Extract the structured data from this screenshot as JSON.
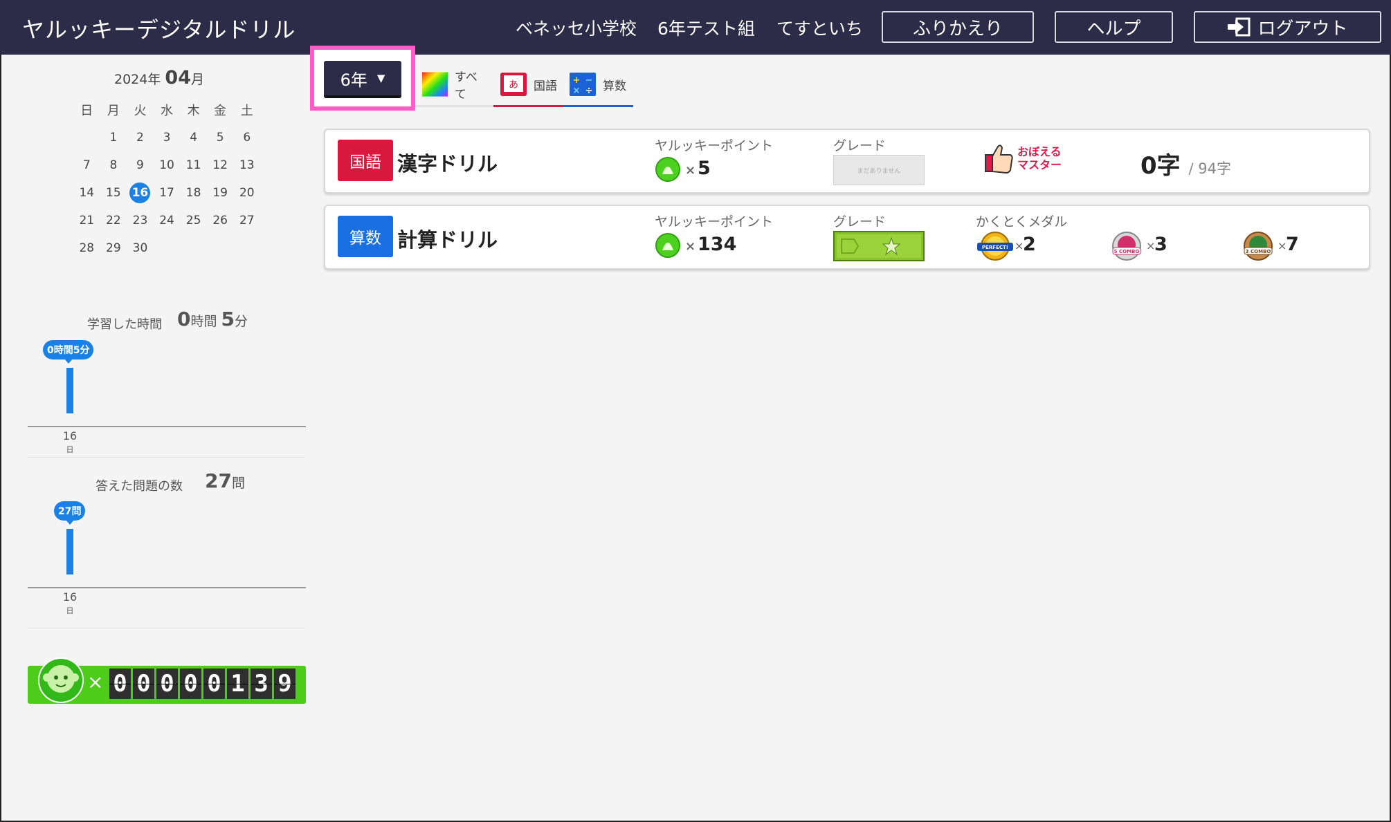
{
  "header": {
    "app_title": "ヤルッキーデジタルドリル",
    "school": "ベネッセ小学校",
    "class_name": "6年テスト組",
    "user_name": "てすといち",
    "review_label": "ふりかえり",
    "help_label": "ヘルプ",
    "logout_label": "ログアウト",
    "bg_color": "#2d2c48"
  },
  "calendar": {
    "year_label": "2024年",
    "month": "04",
    "month_suffix": "月",
    "weekdays": [
      "日",
      "月",
      "火",
      "水",
      "木",
      "金",
      "土"
    ],
    "weeks": [
      [
        "",
        "1",
        "2",
        "3",
        "4",
        "5",
        "6"
      ],
      [
        "7",
        "8",
        "9",
        "10",
        "11",
        "12",
        "13"
      ],
      [
        "14",
        "15",
        "16",
        "17",
        "18",
        "19",
        "20"
      ],
      [
        "21",
        "22",
        "23",
        "24",
        "25",
        "26",
        "27"
      ],
      [
        "28",
        "29",
        "30",
        "",
        "",
        "",
        ""
      ]
    ],
    "today": "16"
  },
  "study_time": {
    "label": "学習した時間",
    "hours": "0",
    "hours_unit": "時間",
    "minutes": "5",
    "minutes_unit": "分",
    "bubble": "0時間5分",
    "day": "16",
    "day_unit": "日",
    "value_minutes": 5
  },
  "answered": {
    "label": "答えた問題の数",
    "count": "27",
    "unit": "問",
    "bubble": "27問",
    "day": "16",
    "day_unit": "日",
    "value": 27
  },
  "points_counter": {
    "x": "×",
    "digits": [
      "0",
      "0",
      "0",
      "0",
      "0",
      "1",
      "3",
      "9"
    ],
    "bar_color": "#4dcc1a"
  },
  "toolbar": {
    "grade_selector": "6年",
    "caret": "▼",
    "tabs": [
      {
        "label": "すべて",
        "icon": "rainbow-icon",
        "underline_color": "#e0e0e0"
      },
      {
        "label": "国語",
        "icon": "japanese-book-icon",
        "underline_color": "#d8183c"
      },
      {
        "label": "算数",
        "icon": "math-symbols-icon",
        "underline_color": "#1a62d6"
      }
    ],
    "highlight_color": "#ff5cc8"
  },
  "cards": [
    {
      "subject": "国語",
      "subject_color": "#d8183c",
      "drill_name": "漢字ドリル",
      "points_label": "ヤルッキーポイント",
      "points_x": "×",
      "points": "5",
      "grade_label": "グレード",
      "grade_plate_text": "まだありません",
      "master_line1": "おぼえる",
      "master_line2": "マスター",
      "kanji_count": "0字",
      "kanji_total": "/ 94字"
    },
    {
      "subject": "算数",
      "subject_color": "#1a6fe0",
      "drill_name": "計算ドリル",
      "points_label": "ヤルッキーポイント",
      "points_x": "×",
      "points": "134",
      "grade_label": "グレード",
      "medals_label": "かくとくメダル",
      "medals": [
        {
          "name": "perfect-medal-icon",
          "x": "×",
          "count": "2",
          "medal_text": "PERFECT!"
        },
        {
          "name": "combo-5-medal-icon",
          "x": "×",
          "count": "3",
          "medal_text": "5 COMBO"
        },
        {
          "name": "combo-3-medal-icon",
          "x": "×",
          "count": "7",
          "medal_text": "3 COMBO"
        }
      ]
    }
  ]
}
